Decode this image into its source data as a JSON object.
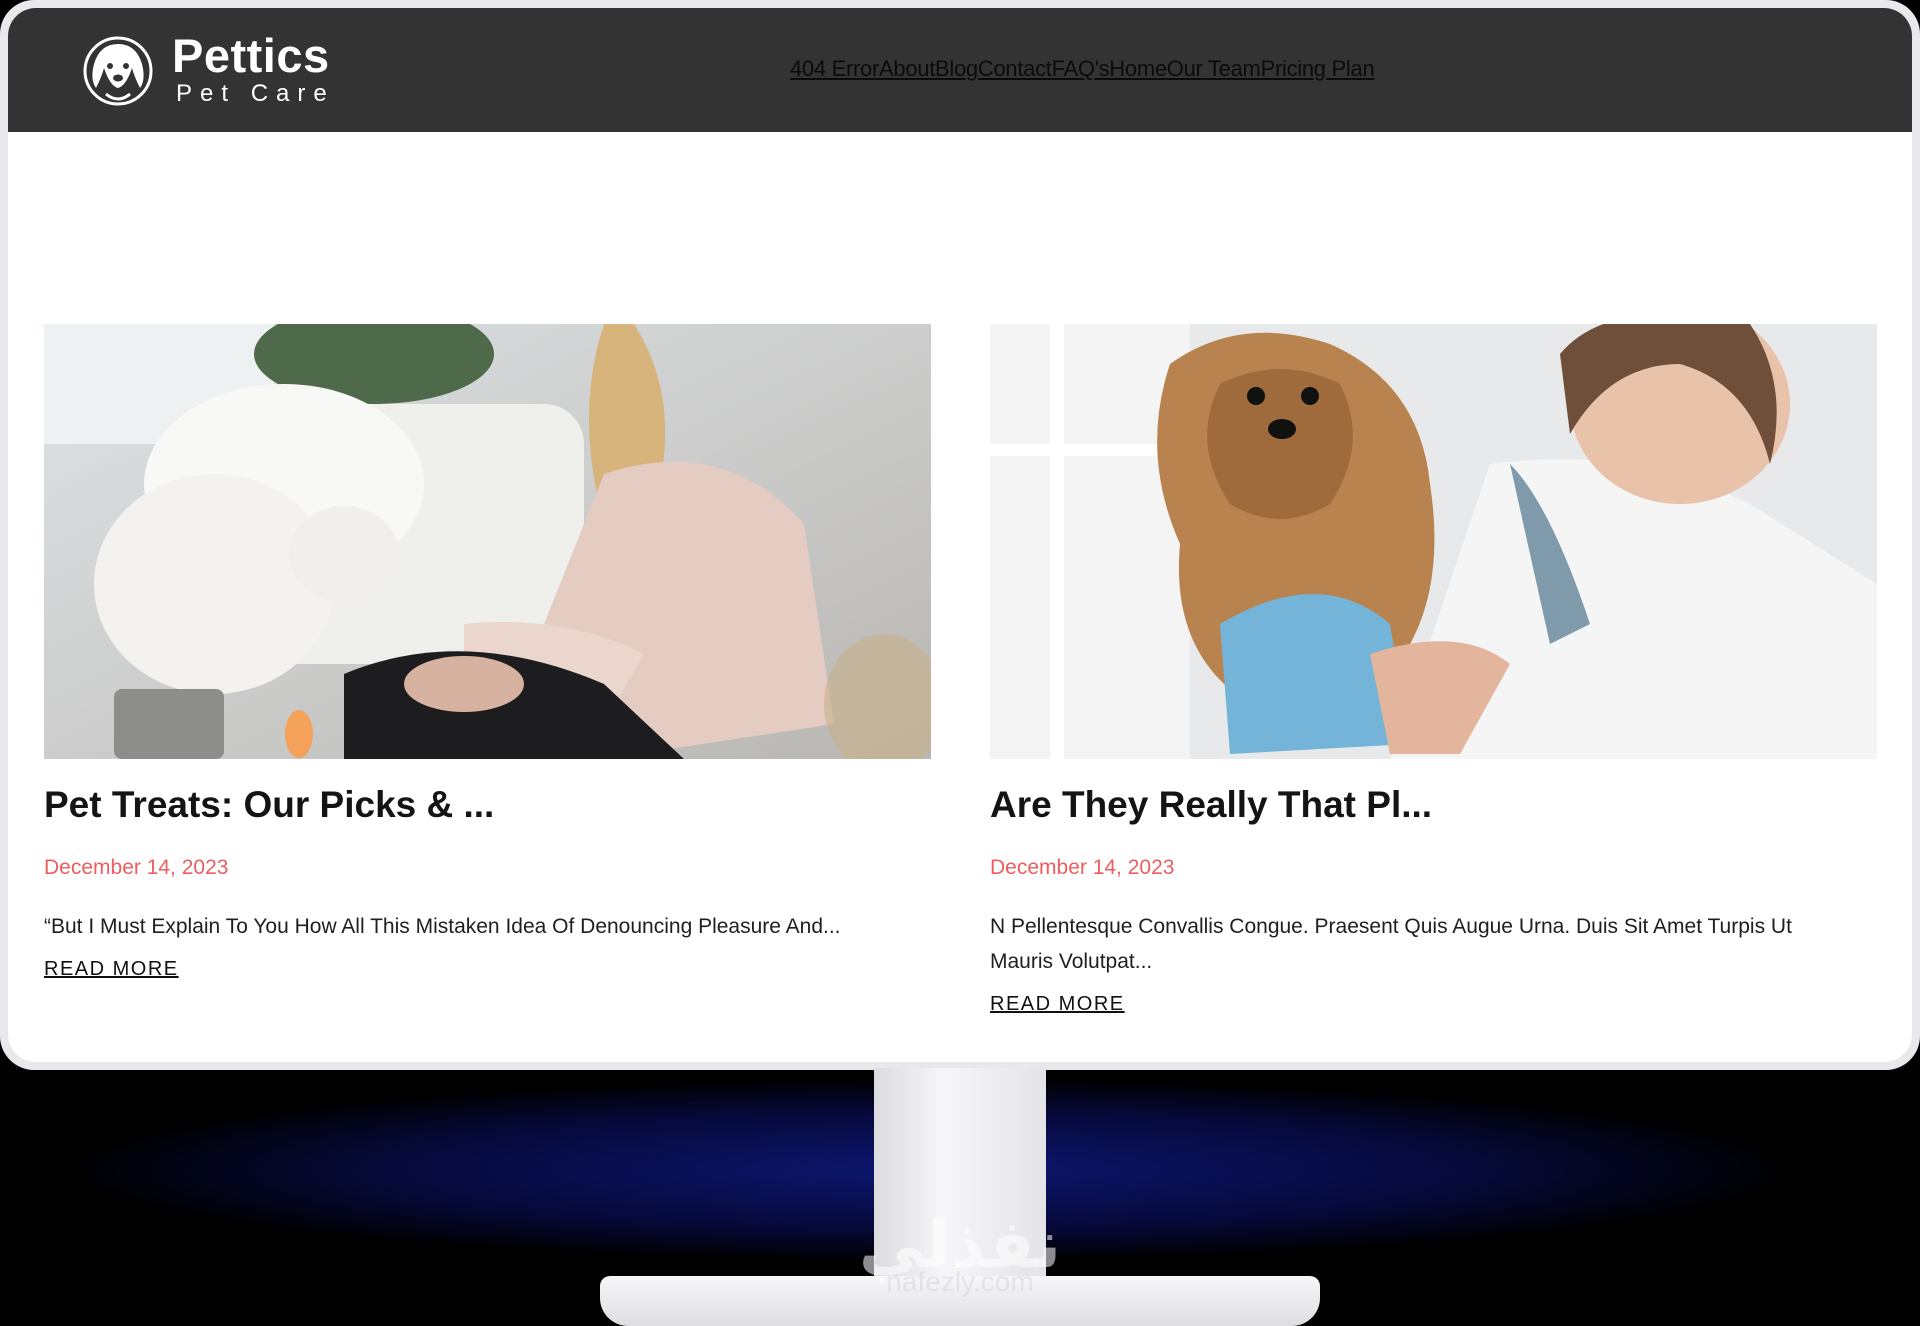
{
  "brand": {
    "name": "Pettics",
    "tagline": "Pet Care"
  },
  "nav": {
    "items": [
      "404 Error",
      "About",
      "Blog",
      "Contact",
      "FAQ's",
      "Home",
      "Our Team",
      "Pricing Plan"
    ]
  },
  "posts": [
    {
      "title": "Pet Treats: Our Picks & ...",
      "date": "December 14, 2023",
      "excerpt": "“But I Must Explain To You How All This Mistaken Idea Of Denouncing Pleasure And...",
      "read_more": "READ MORE",
      "image": "woman-with-white-dog-photo"
    },
    {
      "title": "Are They Really That Pl...",
      "date": "December 14, 2023",
      "excerpt": "N Pellentesque Convallis Congue. Praesent Quis Augue Urna. Duis Sit Amet Turpis Ut Mauris Volutpat...",
      "read_more": "READ MORE",
      "image": "vet-holding-yorkie-photo"
    }
  ],
  "watermark": {
    "arabic": "نفذلي",
    "latin": "nafezly.com"
  },
  "colors": {
    "header_bg": "#333333",
    "date": "#ee5e5e",
    "title": "#141414"
  }
}
